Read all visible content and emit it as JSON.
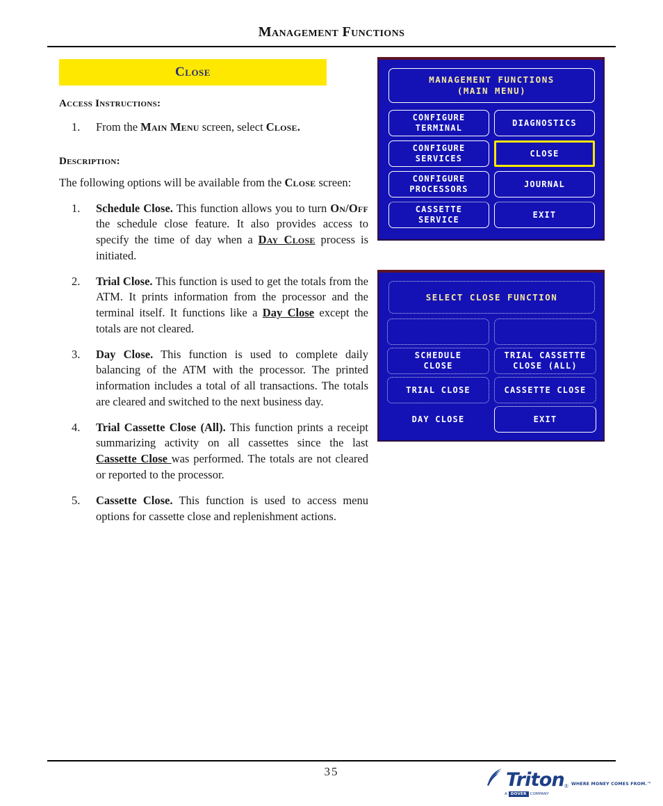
{
  "header": {
    "title": "Management Functions"
  },
  "banner": {
    "label": "Close"
  },
  "access": {
    "heading": "Access Instructions:",
    "items": [
      {
        "num": "1.",
        "parts": [
          {
            "t": "From the ",
            "s": "plain"
          },
          {
            "t": "Main Menu",
            "s": "sc"
          },
          {
            "t": " screen, select ",
            "s": "plain"
          },
          {
            "t": "Close.",
            "s": "sc"
          }
        ]
      }
    ]
  },
  "description": {
    "heading": "Description:",
    "intro_parts": [
      {
        "t": "The following options will be available from the ",
        "s": "plain"
      },
      {
        "t": "Close",
        "s": "sc"
      },
      {
        "t": " screen:",
        "s": "plain"
      }
    ],
    "items": [
      {
        "num": "1.",
        "parts": [
          {
            "t": "Schedule Close.",
            "s": "b"
          },
          {
            "t": "  This function allows you to turn ",
            "s": "plain"
          },
          {
            "t": "On/Off",
            "s": "sc"
          },
          {
            "t": " the schedule close feature. It also provides access to specify the time of day when a ",
            "s": "plain"
          },
          {
            "t": "Day Close",
            "s": "scu"
          },
          {
            "t": " process is initiated.",
            "s": "plain"
          }
        ]
      },
      {
        "num": "2.",
        "parts": [
          {
            "t": "Trial Close.",
            "s": "b"
          },
          {
            "t": " This function is used to get the totals from the ATM.  It prints information from the processor and the terminal itself.  It functions like a ",
            "s": "plain"
          },
          {
            "t": "Day Close",
            "s": "bu"
          },
          {
            "t": " except the totals are not cleared.",
            "s": "plain"
          }
        ]
      },
      {
        "num": "3.",
        "parts": [
          {
            "t": "Day Close.",
            "s": "b"
          },
          {
            "t": "  This function is used to complete daily balancing of the ATM with the processor. The printed information includes a total of all transactions. The totals are cleared and switched to the next business day.",
            "s": "plain"
          }
        ]
      },
      {
        "num": "4.",
        "parts": [
          {
            "t": "Trial Cassette Close (All).",
            "s": "b"
          },
          {
            "t": " This function prints a receipt summarizing activity on all cassettes since the last ",
            "s": "plain"
          },
          {
            "t": "Cassette Close ",
            "s": "bu"
          },
          {
            "t": "was performed. The totals are not cleared or reported to the processor.",
            "s": "plain"
          }
        ]
      },
      {
        "num": "5.",
        "parts": [
          {
            "t": "Cassette Close.",
            "s": "b"
          },
          {
            "t": "  This function is used to access menu options for cassette close and replenishment actions.",
            "s": "plain"
          }
        ]
      }
    ]
  },
  "atm_screens": [
    {
      "id": "main-menu",
      "title_lines": [
        "MANAGEMENT FUNCTIONS",
        "(MAIN MENU)"
      ],
      "buttons": [
        {
          "name": "configure-terminal",
          "lines": [
            "CONFIGURE",
            "TERMINAL"
          ],
          "style": "normal"
        },
        {
          "name": "diagnostics",
          "lines": [
            "DIAGNOSTICS"
          ],
          "style": "normal"
        },
        {
          "name": "configure-services",
          "lines": [
            "CONFIGURE",
            "SERVICES"
          ],
          "style": "normal"
        },
        {
          "name": "close",
          "lines": [
            "CLOSE"
          ],
          "style": "highlight"
        },
        {
          "name": "configure-processors",
          "lines": [
            "CONFIGURE",
            "PROCESSORS"
          ],
          "style": "normal"
        },
        {
          "name": "journal",
          "lines": [
            "JOURNAL"
          ],
          "style": "normal"
        },
        {
          "name": "cassette-service",
          "lines": [
            "CASSETTE",
            "SERVICE"
          ],
          "style": "faint-top"
        },
        {
          "name": "exit",
          "lines": [
            "EXIT"
          ],
          "style": "faint-top"
        }
      ]
    },
    {
      "id": "select-close-function",
      "title_lines": [
        "SELECT CLOSE FUNCTION"
      ],
      "buttons": [
        {
          "name": "blank-left",
          "lines": [
            ""
          ],
          "style": "dotted"
        },
        {
          "name": "blank-right",
          "lines": [
            ""
          ],
          "style": "dotted"
        },
        {
          "name": "schedule-close",
          "lines": [
            "SCHEDULE",
            "CLOSE"
          ],
          "style": "dotted"
        },
        {
          "name": "trial-cassette-close-all",
          "lines": [
            "TRIAL CASSETTE",
            "CLOSE (ALL)"
          ],
          "style": "dotted"
        },
        {
          "name": "trial-close",
          "lines": [
            "TRIAL CLOSE"
          ],
          "style": "dotted"
        },
        {
          "name": "cassette-close",
          "lines": [
            "CASSETTE CLOSE"
          ],
          "style": "dotted"
        },
        {
          "name": "day-close",
          "lines": [
            "DAY CLOSE"
          ],
          "style": "none"
        },
        {
          "name": "exit",
          "lines": [
            "EXIT"
          ],
          "style": "faint-top"
        }
      ]
    }
  ],
  "footer": {
    "page_number": "35",
    "logo_word": "Triton",
    "logo_tm": "®",
    "logo_tagline": "WHERE MONEY COMES FROM.™",
    "logo_sub_a": "A",
    "logo_sub_box": "DOVER",
    "logo_sub_b": "COMPANY"
  },
  "colors": {
    "banner_bg": "#ffe800",
    "banner_text": "#232c7c",
    "atm_bg": "#1412b4",
    "atm_title_text": "#f6e9a0",
    "atm_button_text": "#ffffff",
    "atm_highlight": "#ffe800",
    "logo_blue": "#1d3f87"
  }
}
